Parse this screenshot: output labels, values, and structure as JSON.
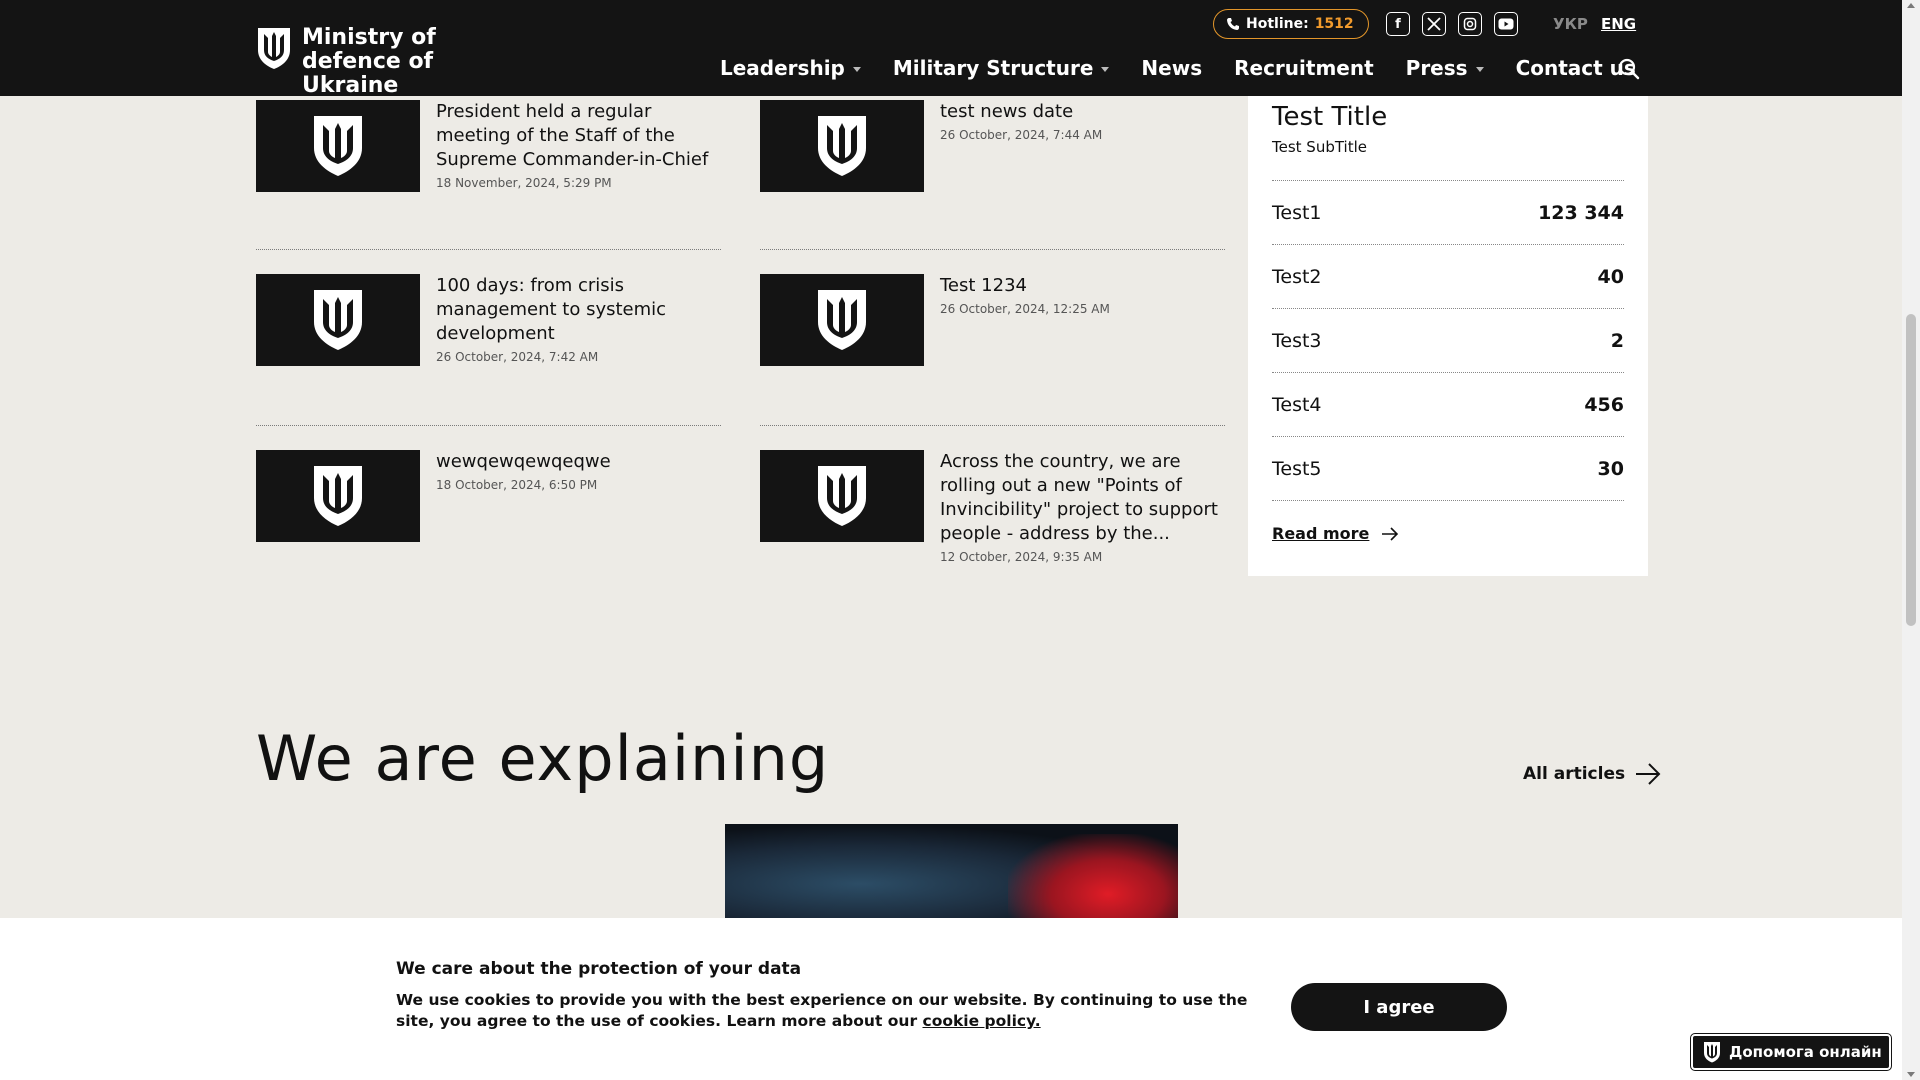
{
  "header": {
    "logo_text": "Ministry of defence of Ukraine",
    "hotline_label": "Hotline:",
    "hotline_number": "1512",
    "social_icons": [
      "facebook-icon",
      "x-twitter-icon",
      "instagram-icon",
      "youtube-icon"
    ],
    "lang_ukr": "УКР",
    "lang_eng": "ENG",
    "nav": [
      {
        "label": "Leadership",
        "has_dropdown": true
      },
      {
        "label": "Military Structure",
        "has_dropdown": true
      },
      {
        "label": "News",
        "has_dropdown": false
      },
      {
        "label": "Recruitment",
        "has_dropdown": false
      },
      {
        "label": "Press",
        "has_dropdown": true
      },
      {
        "label": "Contact us",
        "has_dropdown": false
      }
    ]
  },
  "news": [
    {
      "title": "President held a regular meeting of the Staff of the Supreme Commander-in-Chief",
      "date": "18 November, 2024, 5:29 PM"
    },
    {
      "title": "test news date",
      "date": "26 October, 2024, 7:44 AM"
    },
    {
      "title": "100 days: from crisis management to systemic development",
      "date": "26 October, 2024, 7:42 AM"
    },
    {
      "title": "Test 1234",
      "date": "26 October, 2024, 12:25 AM"
    },
    {
      "title": "wewqewqewqeqwe",
      "date": "18 October, 2024, 6:50 PM"
    },
    {
      "title": "Across the country, we are rolling out a new \"Points of Invincibility\" project to support people - address by the...",
      "date": "12 October, 2024, 9:35 AM"
    }
  ],
  "stats_card": {
    "title": "Test Title",
    "subtitle": "Test SubTitle",
    "rows": [
      {
        "label": "Test1",
        "value": "123 344"
      },
      {
        "label": "Test2",
        "value": "40"
      },
      {
        "label": "Test3",
        "value": "2"
      },
      {
        "label": "Test4",
        "value": "456"
      },
      {
        "label": "Test5",
        "value": "30"
      }
    ],
    "read_more": "Read more"
  },
  "explaining": {
    "title": "We are explaining",
    "all_articles": "All articles"
  },
  "cookie": {
    "title": "We care about the protection of your data",
    "text": "We use cookies to provide you with the best experience on our website. By continuing to use the site, you agree to the use of cookies. Learn more about our ",
    "link": "cookie policy.",
    "button": "I agree"
  },
  "help_widget": {
    "label": "Допомога онлайн"
  },
  "colors": {
    "header_bg": "#141414",
    "page_bg": "#edebe6",
    "accent_orange": "#f29b2c"
  }
}
